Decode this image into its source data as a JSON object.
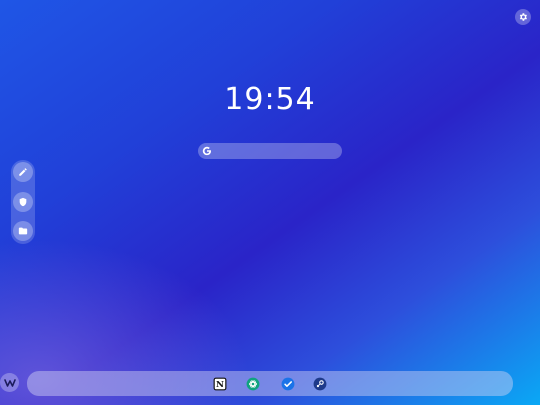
{
  "clock": {
    "time": "19:54"
  },
  "search": {
    "placeholder": "",
    "icon": "google-g-icon"
  },
  "side_dock": {
    "items": [
      {
        "name": "pen-icon"
      },
      {
        "name": "shield-icon"
      },
      {
        "name": "folder-icon"
      }
    ]
  },
  "shelf": {
    "launcher_icon": "launcher-w-icon",
    "apps": [
      {
        "name": "notion-app",
        "glyph": "N"
      },
      {
        "name": "openai-app"
      },
      {
        "name": "tasks-app"
      },
      {
        "name": "satellite-app"
      }
    ]
  },
  "colors": {
    "background_top": "#1f56e6",
    "background_mid": "#2a24c8",
    "background_corner": "#0aa8f5"
  }
}
